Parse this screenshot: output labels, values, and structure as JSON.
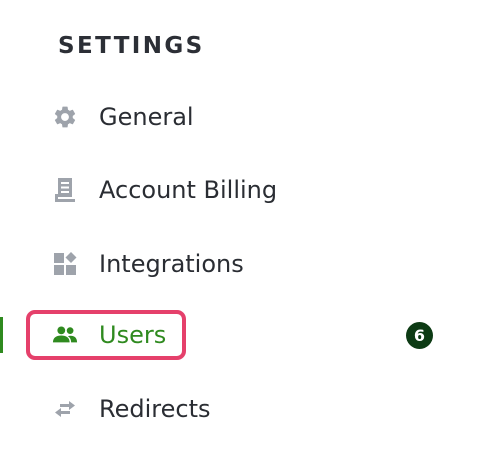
{
  "settings": {
    "heading": "SETTINGS",
    "items": [
      {
        "label": "General",
        "icon": "gear-icon"
      },
      {
        "label": "Account Billing",
        "icon": "receipt-icon"
      },
      {
        "label": "Integrations",
        "icon": "integrations-icon"
      },
      {
        "label": "Users",
        "icon": "users-icon",
        "active": true,
        "badge": "6"
      },
      {
        "label": "Redirects",
        "icon": "redirect-arrows-icon"
      }
    ]
  },
  "colors": {
    "active_green": "#2f8a1f",
    "highlight_pink": "#e5406b",
    "badge_bg": "#0d3b14",
    "icon_gray": "#9ea3ab"
  }
}
